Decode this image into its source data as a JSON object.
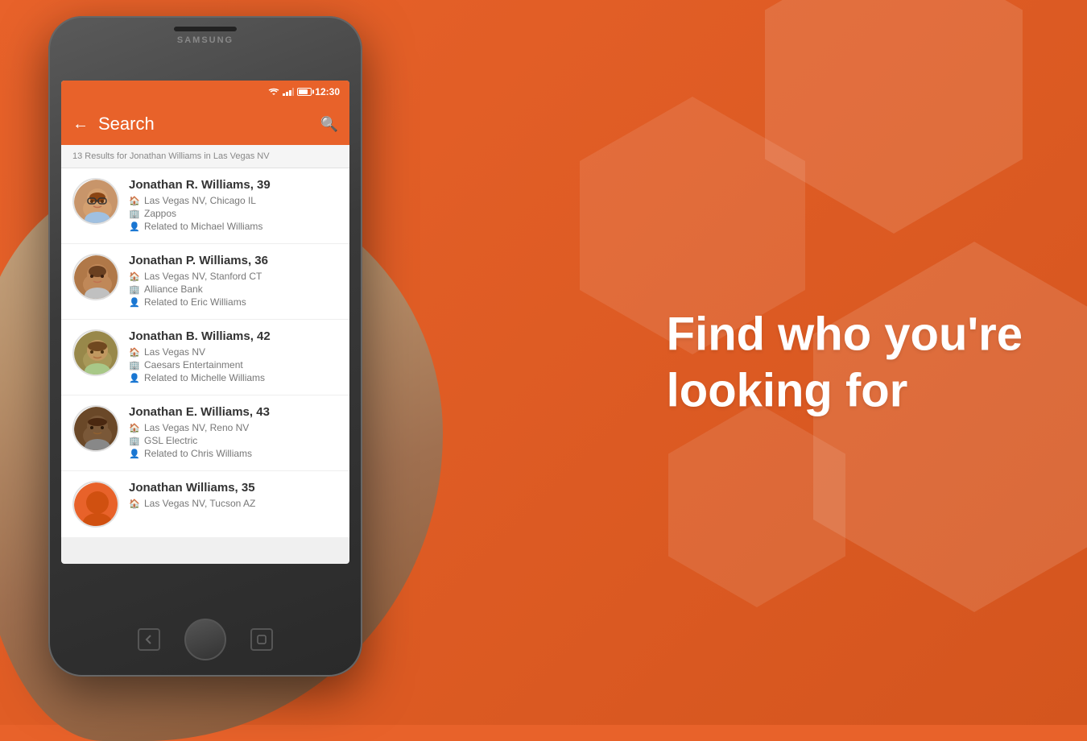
{
  "background": {
    "color": "#E8622A"
  },
  "tagline": {
    "line1": "Find who you're",
    "line2": "looking for"
  },
  "phone": {
    "brand": "SAMSUNG",
    "status_bar": {
      "time": "12:30"
    },
    "header": {
      "title": "Search",
      "back_label": "←",
      "search_icon_label": "🔍"
    },
    "results_text": "13 Results for Jonathan Williams in Las Vegas NV",
    "people": [
      {
        "name": "Jonathan R. Williams, 39",
        "location": "Las Vegas NV, Chicago IL",
        "employer": "Zappos",
        "related": "Related to Michael Williams",
        "avatar_color": "#d4956a"
      },
      {
        "name": "Jonathan P. Williams, 36",
        "location": "Las Vegas NV, Stanford CT",
        "employer": "Alliance Bank",
        "related": "Related to Eric Williams",
        "avatar_color": "#c98050"
      },
      {
        "name": "Jonathan B. Williams, 42",
        "location": "Las Vegas NV",
        "employer": "Caesars Entertainment",
        "related": "Related to Michelle Williams",
        "avatar_color": "#b07545"
      },
      {
        "name": "Jonathan E. Williams, 43",
        "location": "Las Vegas NV, Reno NV",
        "employer": "GSL Electric",
        "related": "Related to Chris Williams",
        "avatar_color": "#7a5535"
      },
      {
        "name": "Jonathan Williams, 35",
        "location": "Las Vegas NV, Tucson AZ",
        "employer": "",
        "related": "",
        "avatar_color": "#E8622A"
      }
    ]
  }
}
